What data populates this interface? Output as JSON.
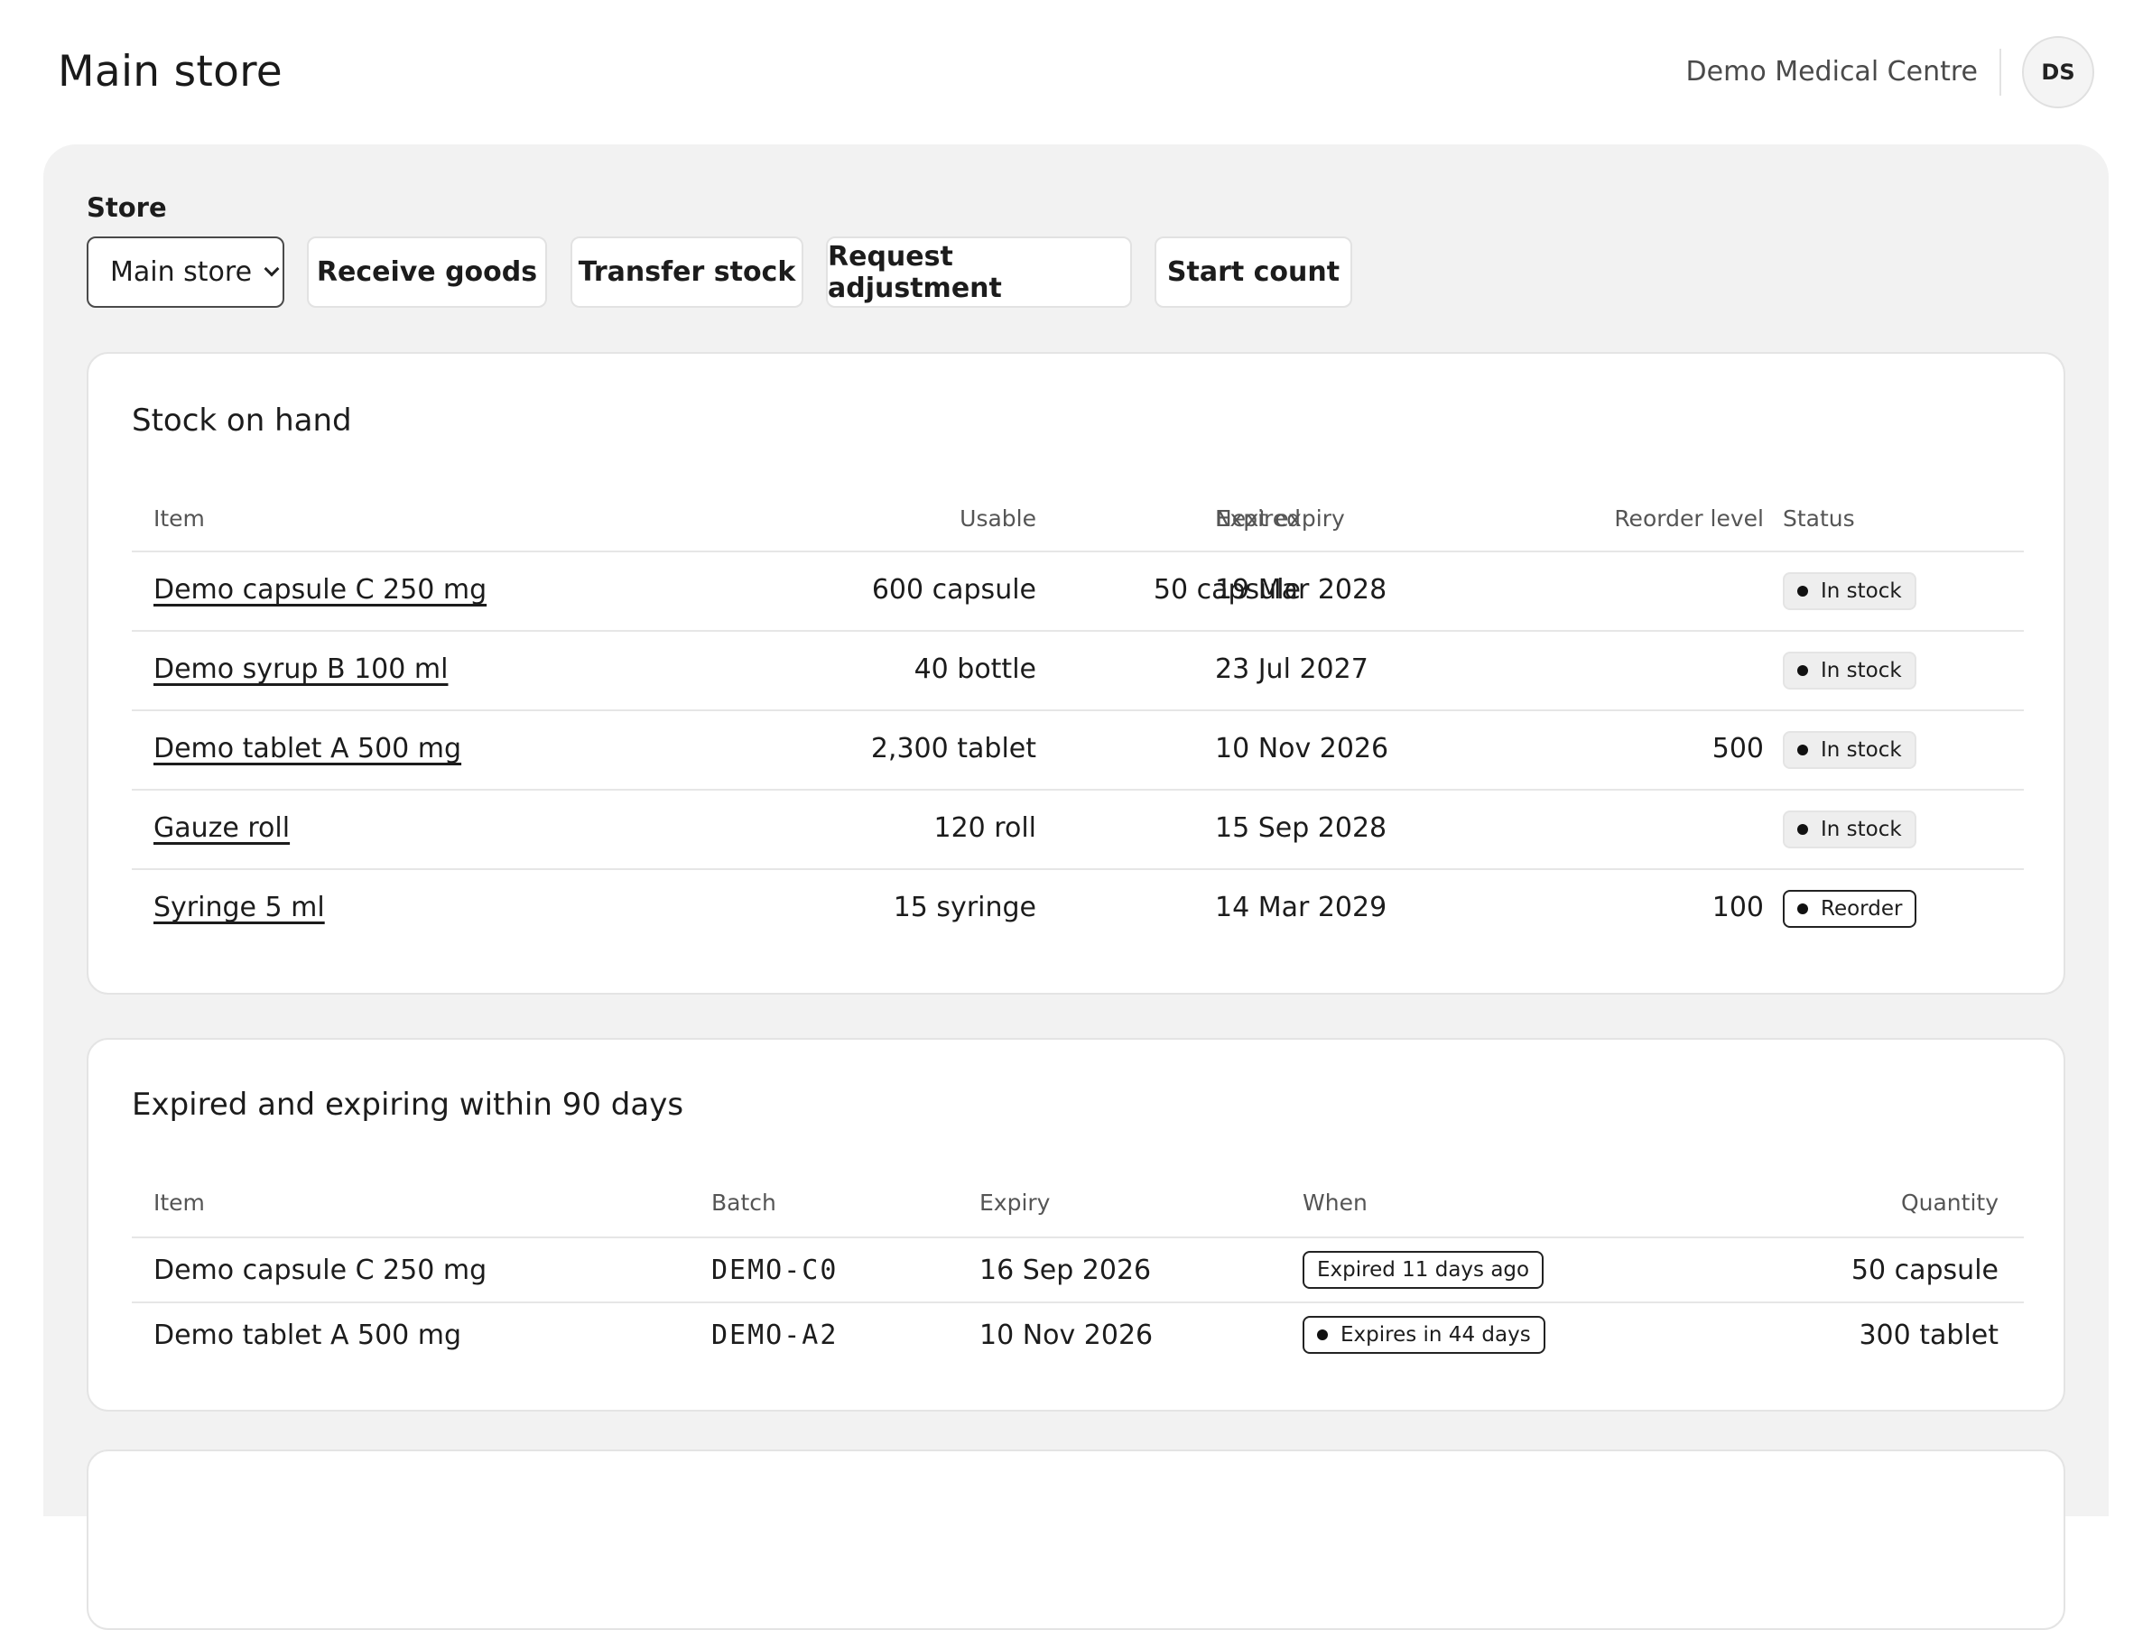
{
  "header": {
    "title": "Main store",
    "organization": "Demo Medical Centre",
    "user_initials": "DS"
  },
  "toolbar": {
    "store_label": "Store",
    "store_selected": "Main store",
    "receive_label": "Receive goods",
    "transfer_label": "Transfer stock",
    "adjust_label": "Request adjustment",
    "count_label": "Start count"
  },
  "stock_on_hand": {
    "title": "Stock on hand",
    "columns": [
      "Item",
      "Usable",
      "Expired",
      "Next expiry",
      "Reorder level",
      "Status"
    ],
    "rows": [
      {
        "item": "Demo capsule C 250 mg",
        "usable": "600 capsule",
        "expired": "50 capsule",
        "next_expiry": "19 Mar 2028",
        "reorder_level": "",
        "status": "In stock"
      },
      {
        "item": "Demo syrup B 100 ml",
        "usable": "40 bottle",
        "expired": "",
        "next_expiry": "23 Jul 2027",
        "reorder_level": "",
        "status": "In stock"
      },
      {
        "item": "Demo tablet A 500 mg",
        "usable": "2,300 tablet",
        "expired": "",
        "next_expiry": "10 Nov 2026",
        "reorder_level": "500",
        "status": "In stock"
      },
      {
        "item": "Gauze roll",
        "usable": "120 roll",
        "expired": "",
        "next_expiry": "15 Sep 2028",
        "reorder_level": "",
        "status": "In stock"
      },
      {
        "item": "Syringe 5 ml",
        "usable": "15 syringe",
        "expired": "",
        "next_expiry": "14 Mar 2029",
        "reorder_level": "100",
        "status": "Reorder"
      }
    ]
  },
  "expiring": {
    "title": "Expired and expiring within 90 days",
    "columns": [
      "Item",
      "Batch",
      "Expiry",
      "When",
      "Quantity"
    ],
    "rows": [
      {
        "item": "Demo capsule C 250 mg",
        "batch": "DEMO-C0",
        "expiry": "16 Sep 2026",
        "when": "Expired 11 days ago",
        "quantity": "50 capsule"
      },
      {
        "item": "Demo tablet A 500 mg",
        "batch": "DEMO-A2",
        "expiry": "10 Nov 2026",
        "when": "Expires in 44 days",
        "quantity": "300 tablet"
      }
    ]
  }
}
